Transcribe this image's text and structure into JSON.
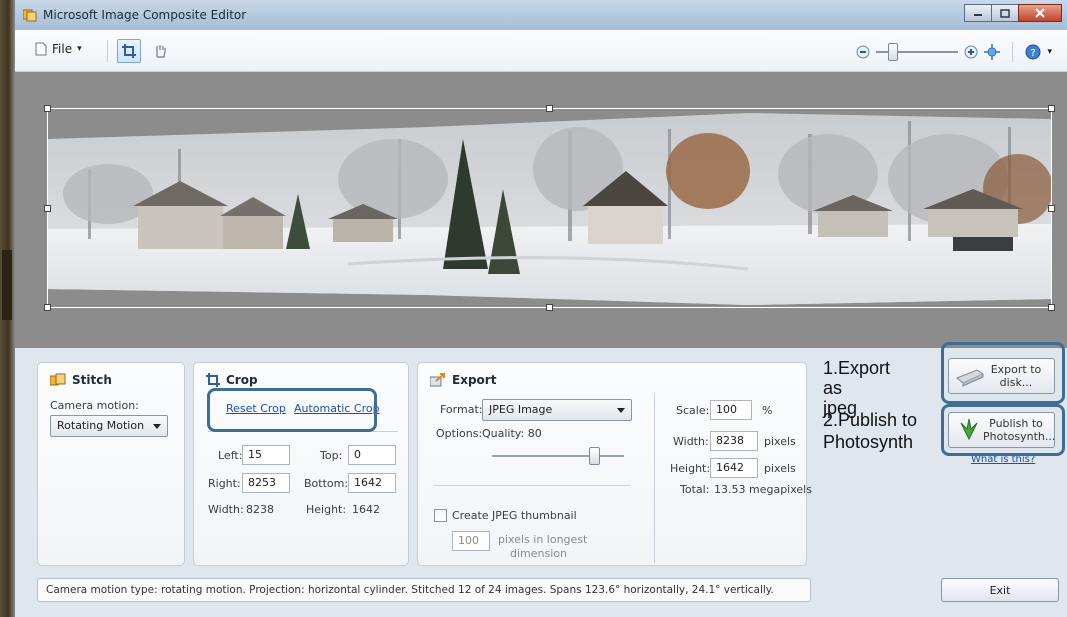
{
  "window": {
    "title": "Microsoft Image Composite Editor"
  },
  "toolbar": {
    "file_label": "File",
    "dropdown_caret": "▾"
  },
  "stitch": {
    "title": "Stitch",
    "camera_motion_label": "Camera motion:",
    "camera_motion_value": "Rotating Motion"
  },
  "crop": {
    "title": "Crop",
    "reset_crop": "Reset Crop",
    "automatic_crop": "Automatic Crop",
    "left_label": "Left:",
    "left_value": "15",
    "top_label": "Top:",
    "top_value": "0",
    "right_label": "Right:",
    "right_value": "8253",
    "bottom_label": "Bottom:",
    "bottom_value": "1642",
    "width_label": "Width:",
    "width_value": "8238",
    "height_label": "Height:",
    "height_value": "1642"
  },
  "export": {
    "title": "Export",
    "format_label": "Format:",
    "format_value": "JPEG Image",
    "options_label": "Options:",
    "quality_label": "Quality: 80",
    "quality_value": 80,
    "thumbnail_label": "Create JPEG thumbnail",
    "thumbnail_pixels": "100",
    "thumbnail_desc_1": "pixels in longest",
    "thumbnail_desc_2": "dimension",
    "scale_label": "Scale:",
    "scale_value": "100",
    "scale_unit": "%",
    "width_label": "Width:",
    "width_value": "8238",
    "width_unit": "pixels",
    "height_label": "Height:",
    "height_value": "1642",
    "height_unit": "pixels",
    "total_label": "Total:",
    "total_value": "13.53 megapixels"
  },
  "actions": {
    "export_disk": "Export to disk...",
    "publish": "Publish to Photosynth...",
    "what_is_this": "What is this?"
  },
  "annotations": {
    "note1_line1": "1.Export",
    "note1_line2": "as",
    "note1_line3": "jpeg",
    "note2_line1": "2.Publish to",
    "note2_line2": "Photosynth"
  },
  "status_text": "Camera motion type: rotating motion. Projection: horizontal cylinder. Stitched 12 of 24 images. Spans 123.6° horizontally, 24.1° vertically.",
  "exit_label": "Exit",
  "colors": {
    "highlight": "#3e6d96",
    "link": "#1a4fb8"
  }
}
